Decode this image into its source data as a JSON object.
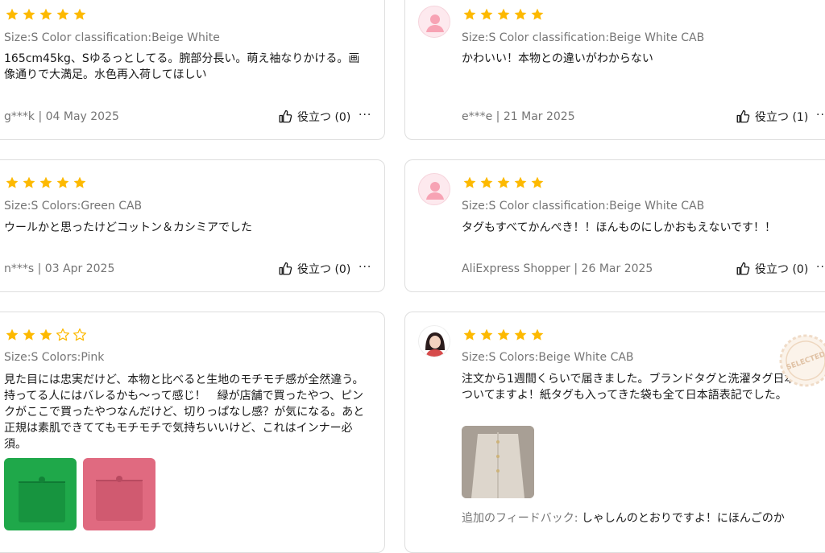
{
  "colors": {
    "star": "#fdb900",
    "star_empty": "#fdb900",
    "border": "#dedede",
    "muted": "#757575"
  },
  "icons": {
    "helpful": "thumbs-up-icon",
    "more": "more-dots-icon",
    "avatar": "user-avatar-icon",
    "stamp": "selected-stamp-icon"
  },
  "reviews": [
    {
      "rating": 5,
      "attrs": "Size:S Color classification:Beige White",
      "text": "165cm45kg、Sゆるっとしてる。腕部分長い。萌え袖なりかける。画像通りで大満足。水色再入荷してほしい",
      "author_date": "g***k | 04 May 2025",
      "helpful": "役立つ (0)",
      "more": "···"
    },
    {
      "rating": 5,
      "attrs": "Size:S Color classification:Beige White CAB",
      "text": "かわいい！本物との違いがわからない",
      "author_date": "e***e | 21 Mar 2025",
      "helpful": "役立つ (1)",
      "more": "···"
    },
    {
      "rating": 5,
      "attrs": "Size:S Colors:Green CAB",
      "text": "ウールかと思ったけどコットン＆カシミアでした",
      "author_date": "n***s | 03 Apr 2025",
      "helpful": "役立つ (0)",
      "more": "···"
    },
    {
      "rating": 5,
      "attrs": "Size:S Color classification:Beige White CAB",
      "text": "タグもすべてかんぺき！！ほんものにしかおもえないです！！",
      "author_date": "AliExpress Shopper | 26 Mar 2025",
      "helpful": "役立つ (0)",
      "more": "···"
    },
    {
      "rating": 3,
      "attrs": "Size:S Colors:Pink",
      "text": "見た目には忠実だけど、本物と比べると生地のモチモチ感が全然違う。持ってる人にはバレるかも〜って感じ！　緑が店舗で買ったやつ、ピンクがここで買ったやつなんだけど、切りっぱなし感？が気になる。あと正規は素肌できててもモチモチで気持ちいいけど、これはインナー必須。"
    },
    {
      "rating": 5,
      "attrs": "Size:S Colors:Beige White CAB",
      "text": "注文から1週間くらいで届きました。ブランドタグと洗濯タグ日本語でついてますよ！紙タグも入ってきた袋も全て日本語表記でした。",
      "feedback_label": "追加のフィードバック:",
      "feedback_text": "しゃしんのとおりですよ！にほんごのか"
    }
  ]
}
